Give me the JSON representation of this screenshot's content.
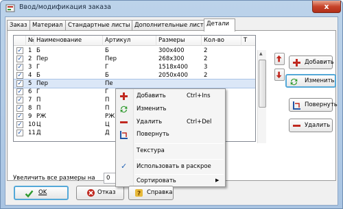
{
  "window": {
    "title": "Ввод/модификация заказа",
    "close": "x"
  },
  "tabs": [
    {
      "label": "Заказ"
    },
    {
      "label": "Материал"
    },
    {
      "label": "Стандартные листы"
    },
    {
      "label": "Дополнительные листы"
    },
    {
      "label": "Детали"
    }
  ],
  "table": {
    "columns": [
      "№",
      "Наименование",
      "Артикул",
      "Размеры",
      "Кол-во",
      "Т"
    ],
    "rows": [
      {
        "num": "1",
        "name": "Б",
        "art": "Б",
        "size": "300x400",
        "qty": "2"
      },
      {
        "num": "2",
        "name": "Пер",
        "art": "Пер",
        "size": "268x300",
        "qty": "2"
      },
      {
        "num": "3",
        "name": "Г",
        "art": "Г",
        "size": "1518x400",
        "qty": "3"
      },
      {
        "num": "4",
        "name": "Б",
        "art": "Б",
        "size": "2050x400",
        "qty": "2"
      },
      {
        "num": "5",
        "name": "Пер",
        "art": "Пе",
        "size": "",
        "qty": ""
      },
      {
        "num": "6",
        "name": "Г",
        "art": "Г",
        "size": "",
        "qty": ""
      },
      {
        "num": "7",
        "name": "П",
        "art": "П",
        "size": "",
        "qty": ""
      },
      {
        "num": "8",
        "name": "П",
        "art": "П",
        "size": "",
        "qty": ""
      },
      {
        "num": "9",
        "name": "РЖ",
        "art": "РЖ",
        "size": "",
        "qty": ""
      },
      {
        "num": "10",
        "name": "Ц",
        "art": "Ц",
        "size": "",
        "qty": ""
      },
      {
        "num": "11",
        "name": "Д",
        "art": "Д",
        "size": "",
        "qty": ""
      }
    ]
  },
  "side_buttons": {
    "add": "Добавить",
    "edit": "Изменить",
    "rotate": "Повернуть",
    "delete": "Удалить"
  },
  "increase": {
    "label": "Увеличить все размеры на",
    "value": "0"
  },
  "bottom_buttons": {
    "ok": "OK",
    "cancel": "Отказ",
    "help": "Справка"
  },
  "context_menu": {
    "add": "Добавить",
    "add_shortcut": "Ctrl+Ins",
    "edit": "Изменить",
    "delete": "Удалить",
    "delete_shortcut": "Ctrl+Del",
    "rotate": "Повернуть",
    "texture": "Текстура",
    "use_in_cutting": "Использовать в раскрое",
    "sort": "Сортировать"
  },
  "colors": {
    "accent_red": "#c0281f",
    "accent_green": "#2f9a2e",
    "accent_blue": "#2254a6",
    "selection": "#dbe7f7"
  }
}
